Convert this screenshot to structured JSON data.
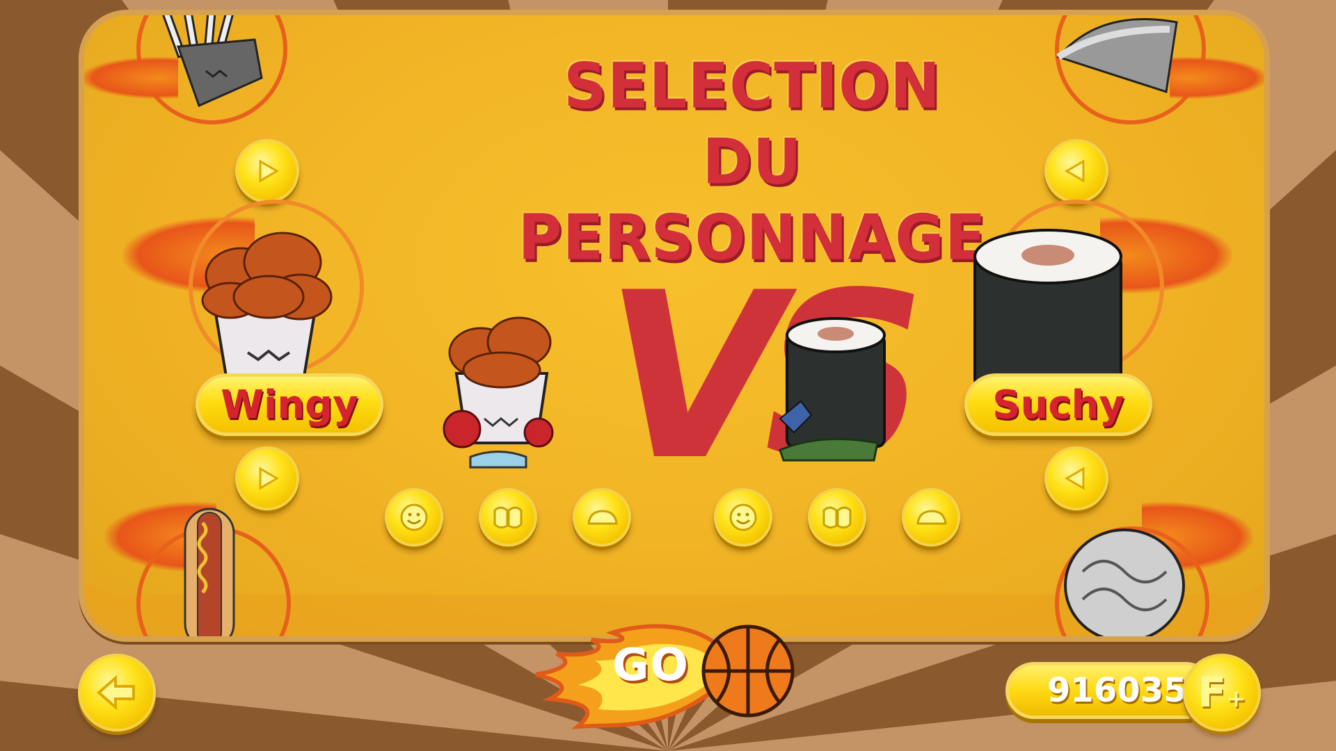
{
  "screen": {
    "title": "SELECTION DU PERSONNAGE",
    "vs_text": "VS",
    "go_label": "GO !",
    "coins": "916035",
    "currency_icon_text": "F",
    "currency_plus": "+"
  },
  "players": [
    {
      "name": "Wingy",
      "food": "fried-chicken-bucket"
    },
    {
      "name": "Suchy",
      "food": "sushi-roll"
    }
  ],
  "carousel_left": {
    "top": "fries",
    "bottom": "hot-dog"
  },
  "carousel_right": {
    "top": "taco",
    "bottom": "rice-ball"
  },
  "stat_icons": [
    "smiley-icon",
    "fists-icon",
    "shoe-icon"
  ],
  "colors": {
    "board": "#f0b224",
    "title_red": "#d32f3a",
    "button_yellow": "#ffe21a",
    "flame_orange": "#e8611c"
  }
}
